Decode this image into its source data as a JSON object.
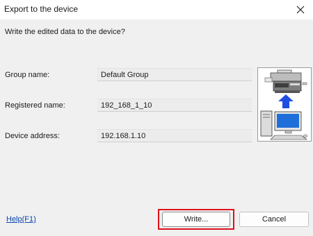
{
  "window": {
    "title": "Export to the device",
    "close_icon": "close-icon"
  },
  "prompt": "Write the edited data to the device?",
  "fields": [
    {
      "label": "Group name:",
      "value": "Default Group"
    },
    {
      "label": "Registered name:",
      "value": "192_168_1_10"
    },
    {
      "label": "Device address:",
      "value": "192.168.1.10"
    }
  ],
  "illustration": {
    "icons": [
      "printer-icon",
      "arrow-up-icon",
      "computer-icon"
    ],
    "arrow_color": "#1f4fe0",
    "screen_color": "#1e6fd9"
  },
  "footer": {
    "help_link": "Help(F1)",
    "write_button": "Write...",
    "cancel_button": "Cancel"
  },
  "colors": {
    "highlight": "#e0101c",
    "link": "#0645ad"
  }
}
